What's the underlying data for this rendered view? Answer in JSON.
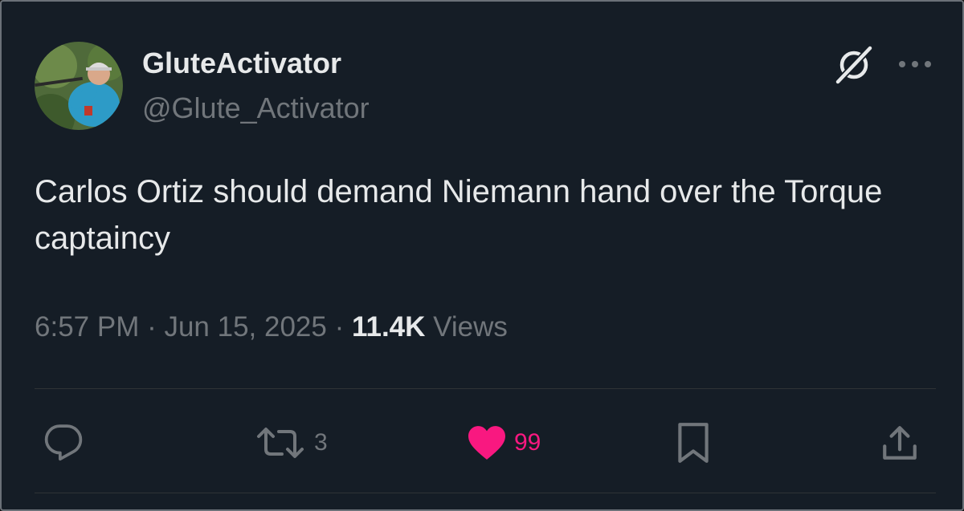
{
  "tweet": {
    "author": {
      "display_name": "GluteActivator",
      "handle": "@Glute_Activator"
    },
    "text": "Carlos Ortiz should demand Niemann hand over the Torque captaincy",
    "timestamp": "6:57 PM · Jun 15, 2025 · ",
    "views_count": "11.4K",
    "views_label": " Views"
  },
  "actions": {
    "retweets": "3",
    "likes": "99"
  },
  "icons": {
    "grok": "grok-icon",
    "more": "more-options-icon",
    "reply": "reply-icon",
    "retweet": "retweet-icon",
    "like": "heart-icon",
    "bookmark": "bookmark-icon",
    "share": "share-icon"
  },
  "colors": {
    "background": "#151d26",
    "text_primary": "#e7e9ea",
    "text_secondary": "#71767b",
    "like_active": "#f91880",
    "divider": "#2f3336"
  }
}
